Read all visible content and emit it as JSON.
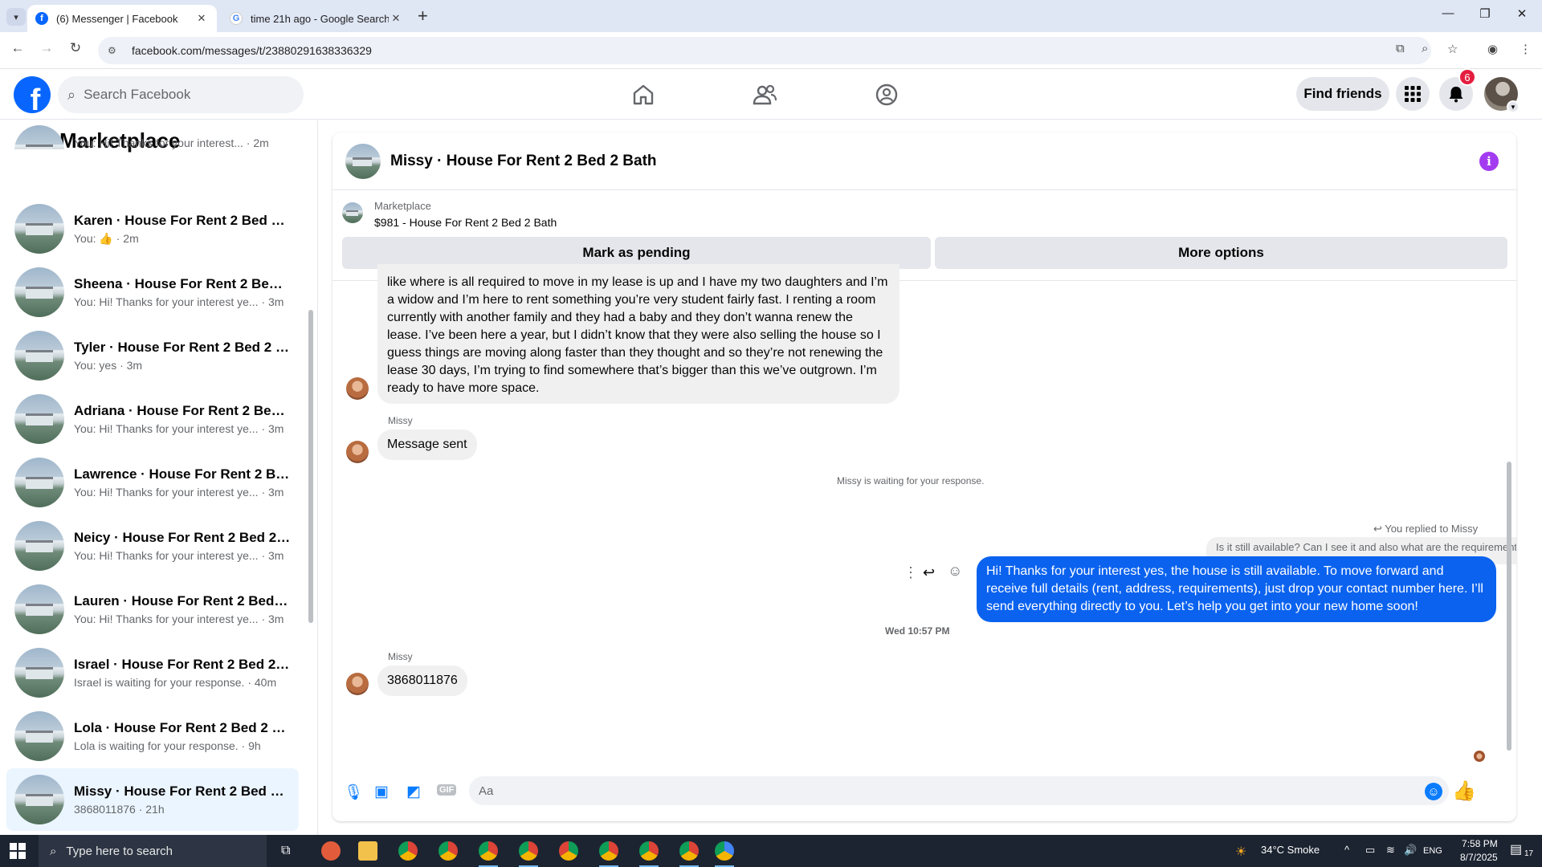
{
  "browser": {
    "tabs": [
      {
        "label": "(6) Messenger | Facebook",
        "active": true
      },
      {
        "label": "time 21h ago - Google Search",
        "active": false
      }
    ],
    "url": "facebook.com/messages/t/23880291638336329"
  },
  "fb": {
    "search_placeholder": "Search Facebook",
    "find_friends": "Find friends",
    "notification_count": "6",
    "colors": {
      "brand": "#0866ff",
      "badge": "#e41e3f"
    }
  },
  "sidebar": {
    "title": "Marketplace",
    "partial_top_snippet": "You: Hi! Thanks for your interest... · 2m",
    "conversations": [
      {
        "name": "Karen · House For Rent 2 Bed 2 ...",
        "snippet": "You: 👍 · 2m"
      },
      {
        "name": "Sheena · House For Rent 2 Bed 2...",
        "snippet": "You: Hi! Thanks for your interest ye... · 3m"
      },
      {
        "name": "Tyler · House For Rent 2 Bed 2 B...",
        "snippet": "You: yes · 3m"
      },
      {
        "name": "Adriana · House For Rent 2 Bed ...",
        "snippet": "You: Hi! Thanks for your interest ye... · 3m"
      },
      {
        "name": "Lawrence · House For Rent 2 Be...",
        "snippet": "You: Hi! Thanks for your interest ye... · 3m"
      },
      {
        "name": "Neicy · House For Rent 2 Bed 2 ...",
        "snippet": "You: Hi! Thanks for your interest ye... · 3m"
      },
      {
        "name": "Lauren · House For Rent 2 Bed 2 ...",
        "snippet": "You: Hi! Thanks for your interest ye... · 3m"
      },
      {
        "name": "Israel · House For Rent 2 Bed 2 B...",
        "snippet": "Israel is waiting for your response. · 40m"
      },
      {
        "name": "Lola · House For Rent 2 Bed 2 Ba...",
        "snippet": "Lola is waiting for your response. · 9h"
      },
      {
        "name": "Missy · House For Rent 2 Bed 2 ...",
        "snippet": "3868011876 · 21h"
      }
    ]
  },
  "chat": {
    "title": "Missy · House For Rent 2 Bed 2 Bath",
    "marketplace_label": "Marketplace",
    "listing": "$981 - House For Rent 2 Bed 2 Bath",
    "mark_pending": "Mark as pending",
    "more_options": "More options",
    "long_message": "like where is all required to move in my lease is up and I have my two daughters and I’m a widow and I’m here to rent something you’re very student fairly fast. I renting a room currently with another family and they had a baby and they don’t wanna renew the lease. I’ve been here a year, but I didn’t know that they were also selling the house so I guess things are moving along faster than they thought and so they’re not renewing the lease 30 days, I’m trying to find somewhere that’s bigger than this we’ve outgrown. I’m ready to have more space.",
    "sender_name": "Missy",
    "message_sent": "Message sent",
    "waiting_notice": "Missy is waiting for your response.",
    "replied_to": "You replied to Missy",
    "quoted_text": "Is it still available? Can I see it and also what are the requirements o...",
    "outgoing_message": "Hi! Thanks for your interest yes, the house is still available. To move forward and receive full details (rent, address, requirements), just drop your contact number here. I’ll send everything directly to you. Let’s help you get into your new home soon!",
    "timestamp": "Wed 10:57 PM",
    "last_message": "3868011876",
    "composer_placeholder": "Aa"
  },
  "taskbar": {
    "search_placeholder": "Type here to search",
    "weather": "34°C  Smoke",
    "lang": "ENG",
    "time": "7:58 PM",
    "date": "8/7/2025",
    "notif_count": "17"
  }
}
